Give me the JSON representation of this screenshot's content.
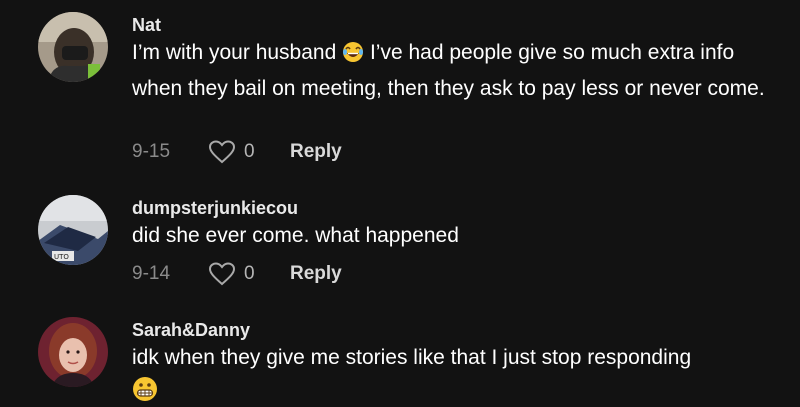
{
  "comments": [
    {
      "username": "Nat",
      "text_before_emoji": "I’m with your husband ",
      "emoji": "laughing-emoji",
      "text_after_emoji": " I’ve had people give so much extra info when they bail on meeting, then they ask to pay less or never come.",
      "date": "9-15",
      "likes": "0",
      "reply_label": "Reply"
    },
    {
      "username": "dumpsterjunkiecou",
      "text": "did she ever come. what happened",
      "date": "9-14",
      "likes": "0",
      "reply_label": "Reply"
    },
    {
      "username": "Sarah&Danny",
      "text": "idk when they give me stories like that I just stop responding",
      "emoji": "grimacing-emoji"
    }
  ],
  "icons": {
    "like": "heart-outline-icon"
  },
  "colors": {
    "background": "#121212",
    "date": "#8a8a8a",
    "text": "#ffffff"
  }
}
